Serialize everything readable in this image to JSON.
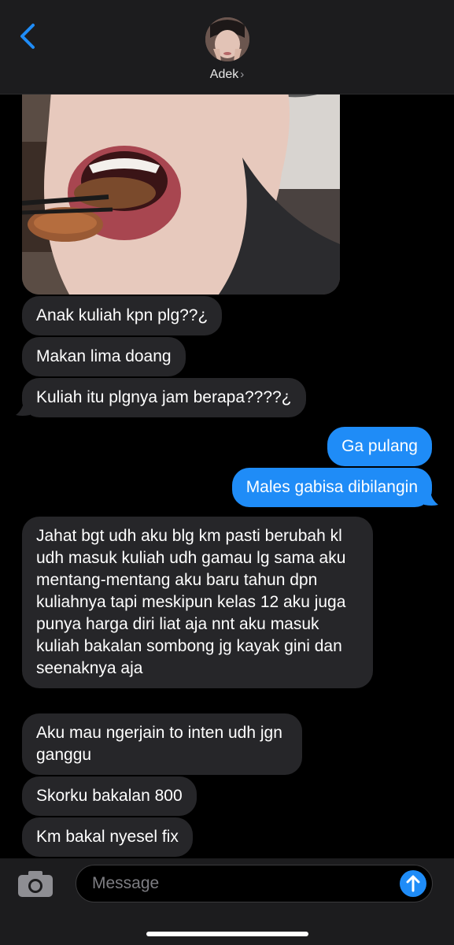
{
  "header": {
    "contact_name": "Adek",
    "chevron": "›"
  },
  "messages": [
    {
      "id": "m1",
      "direction": "incoming",
      "text": "Anak kuliah kpn plg??¿"
    },
    {
      "id": "m2",
      "direction": "incoming",
      "text": "Makan lima doang"
    },
    {
      "id": "m3",
      "direction": "incoming",
      "text": "Kuliah itu plgnya jam berapa????¿"
    },
    {
      "id": "m4",
      "direction": "outgoing",
      "text": "Ga pulang"
    },
    {
      "id": "m5",
      "direction": "outgoing",
      "text": "Males gabisa dibilangin"
    },
    {
      "id": "m6",
      "direction": "incoming",
      "text": "Jahat bgt udh aku blg km pasti berubah kl udh masuk kuliah udh gamau lg sama aku mentang-mentang aku baru tahun dpn kuliahnya tapi meskipun kelas 12 aku juga punya harga diri liat aja nnt aku masuk kuliah bakalan sombong jg kayak gini dan seenaknya aja"
    },
    {
      "id": "m7",
      "direction": "incoming",
      "text": "Aku mau ngerjain to inten udh jgn ganggu"
    },
    {
      "id": "m8",
      "direction": "incoming",
      "text": "Skorku bakalan 800"
    },
    {
      "id": "m9",
      "direction": "incoming",
      "text": "Km bakal nyesel fix"
    }
  ],
  "composer": {
    "placeholder": "Message"
  },
  "icons": {
    "back": "chevron-left-icon",
    "camera": "camera-icon",
    "send": "arrow-up-icon"
  },
  "colors": {
    "accent": "#1f8cf7",
    "incoming_bubble": "#262629",
    "background": "#000000"
  }
}
